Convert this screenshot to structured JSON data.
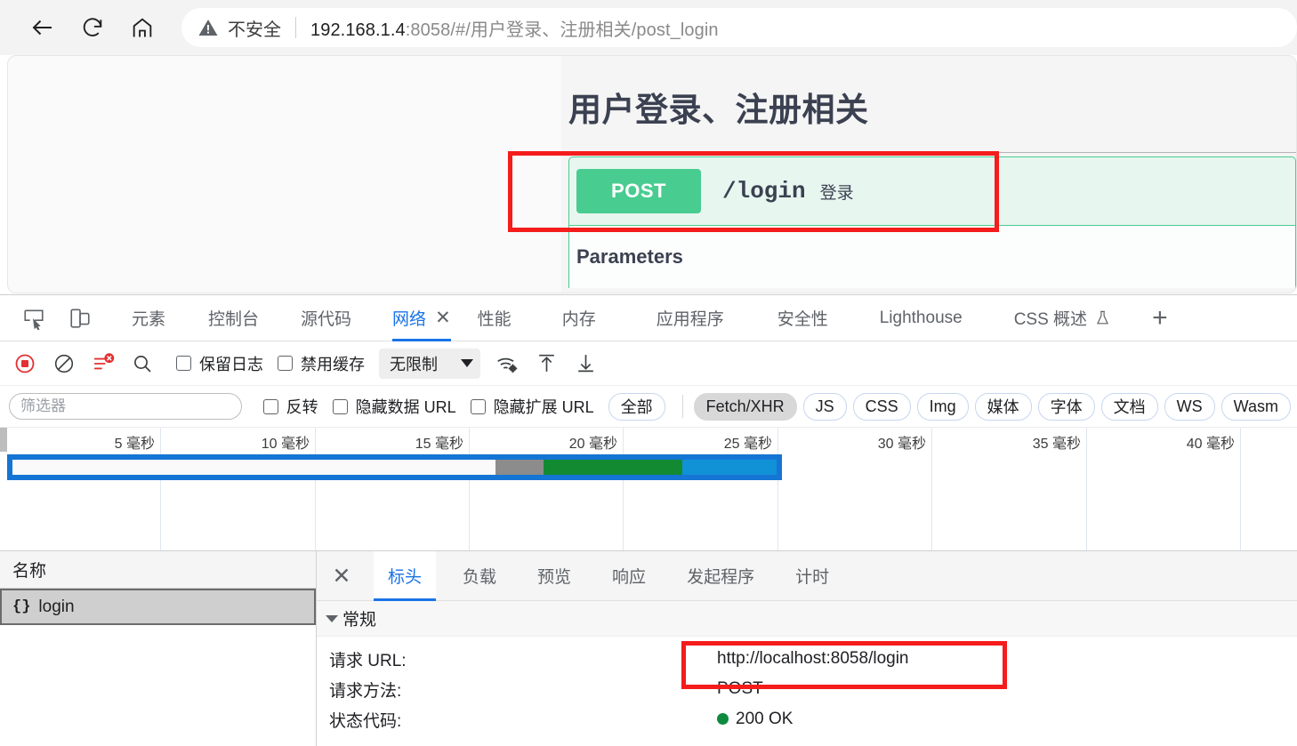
{
  "browser": {
    "back_label": "back-arrow",
    "reload_label": "reload",
    "home_label": "home",
    "security_text": "不安全",
    "url_host": "192.168.1.4",
    "url_rest": ":8058/#/用户登录、注册相关/post_login"
  },
  "swagger": {
    "title": "用户登录、注册相关",
    "method": "POST",
    "path": "/login",
    "summary": "登录",
    "parameters_heading": "Parameters",
    "method_color": "#49cc90",
    "block_bg": "#e8f6f0"
  },
  "devtools": {
    "tabs": [
      {
        "label": "元素",
        "active": false
      },
      {
        "label": "控制台",
        "active": false
      },
      {
        "label": "源代码",
        "active": false
      },
      {
        "label": "网络",
        "active": true,
        "closable": true
      },
      {
        "label": "性能",
        "active": false
      },
      {
        "label": "内存",
        "active": false
      },
      {
        "label": "应用程序",
        "active": false
      },
      {
        "label": "安全性",
        "active": false
      },
      {
        "label": "Lighthouse",
        "active": false
      },
      {
        "label": "CSS 概述",
        "active": false,
        "beaker": true
      }
    ],
    "add_tab_label": "+",
    "toolbar": {
      "record_title": "record",
      "clear_title": "clear",
      "filter_title": "filter",
      "search_title": "search",
      "preserve_log_label": "保留日志",
      "disable_cache_label": "禁用缓存",
      "throttle_value": "无限制",
      "wifi_title": "network-conditions",
      "import_title": "import-har",
      "export_title": "export-har"
    },
    "filters": {
      "placeholder": "筛选器",
      "invert_label": "反转",
      "hide_data_urls_label": "隐藏数据 URL",
      "hide_ext_urls_label": "隐藏扩展 URL",
      "types": [
        {
          "label": "全部",
          "selected": false
        },
        {
          "label": "Fetch/XHR",
          "selected": true
        },
        {
          "label": "JS",
          "selected": false
        },
        {
          "label": "CSS",
          "selected": false
        },
        {
          "label": "Img",
          "selected": false
        },
        {
          "label": "媒体",
          "selected": false
        },
        {
          "label": "字体",
          "selected": false
        },
        {
          "label": "文档",
          "selected": false
        },
        {
          "label": "WS",
          "selected": false
        },
        {
          "label": "Wasm",
          "selected": false
        }
      ]
    },
    "overview": {
      "ticks": [
        "5 毫秒",
        "10 毫秒",
        "15 毫秒",
        "20 毫秒",
        "25 毫秒",
        "30 毫秒",
        "35 毫秒",
        "40 毫秒"
      ],
      "bar_segments": [
        {
          "color": "#fafafa",
          "width_pct": 63.2
        },
        {
          "color": "#8c8c8c",
          "width_pct": 6.3
        },
        {
          "color": "#128a32",
          "width_pct": 18.2
        },
        {
          "color": "#1191d6",
          "width_pct": 12.3
        }
      ],
      "border_color": "#1575d4"
    },
    "requests": {
      "column_name": "名称",
      "rows": [
        {
          "icon": "{}",
          "name": "login",
          "selected": true
        }
      ]
    },
    "detail": {
      "close_label": "✕",
      "tabs": [
        {
          "label": "标头",
          "active": true
        },
        {
          "label": "负载",
          "active": false
        },
        {
          "label": "预览",
          "active": false
        },
        {
          "label": "响应",
          "active": false
        },
        {
          "label": "发起程序",
          "active": false
        },
        {
          "label": "计时",
          "active": false
        }
      ],
      "section_general": "常规",
      "rows": [
        {
          "key": "请求 URL:",
          "value": "http://localhost:8058/login",
          "dot": false
        },
        {
          "key": "请求方法:",
          "value": "POST",
          "dot": false
        },
        {
          "key": "状态代码:",
          "value": "200 OK",
          "dot": true
        }
      ]
    }
  },
  "annotations": {
    "accent_color": "#f51c1c",
    "box_operation": "post-login-operation-highlight",
    "box_url": "request-url-highlight"
  }
}
